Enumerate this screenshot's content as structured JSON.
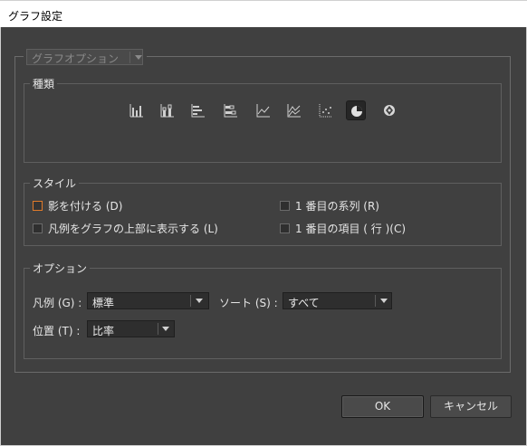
{
  "window": {
    "title": "グラフ設定"
  },
  "graph_option_dropdown": {
    "label": "グラフオプション"
  },
  "type_group": {
    "legend": "種類",
    "icons": [
      "column-graph-icon",
      "stacked-column-graph-icon",
      "bar-graph-icon",
      "stacked-bar-graph-icon",
      "line-graph-icon",
      "area-graph-icon",
      "scatter-graph-icon",
      "pie-graph-icon",
      "radar-graph-icon"
    ],
    "selected_index": 7
  },
  "style_group": {
    "legend": "スタイル",
    "shadow": "影を付ける (D)",
    "legend_top": "凡例をグラフの上部に表示する (L)",
    "first_series": "1 番目の系列 (R)",
    "first_item": "1 番目の項目 ( 行 )(C)"
  },
  "option_group": {
    "legend": "オプション",
    "legend_label": "凡例 (G) :",
    "legend_value": "標準",
    "sort_label": "ソート (S) :",
    "sort_value": "すべて",
    "position_label": "位置 (T) :",
    "position_value": "比率"
  },
  "buttons": {
    "ok": "OK",
    "cancel": "キャンセル"
  },
  "colors": {
    "focus_accent": "#e07a2a",
    "dialog_bg": "#404040"
  }
}
